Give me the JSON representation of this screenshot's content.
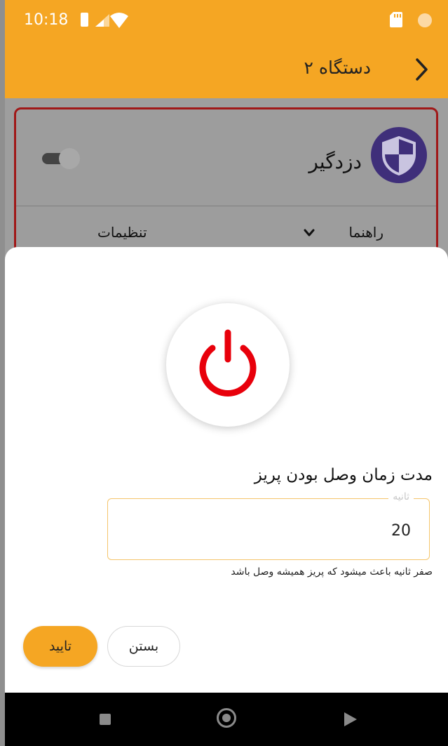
{
  "status_bar": {
    "time": "10:18",
    "icons": [
      "battery-icon",
      "signal-icon",
      "wifi-icon",
      "sd-card-icon",
      "status-dot-icon"
    ]
  },
  "app_bar": {
    "title": "دستگاه ۲",
    "back_icon": "chevron-right-icon"
  },
  "device_card": {
    "title": "دزدگیر",
    "avatar_icon": "shield-icon",
    "toggle_on": false,
    "help_label": "راهنما",
    "settings_label": "تنظیمات"
  },
  "sheet": {
    "power_icon": "power-icon",
    "duration_label": "مدت زمان وصل بودن پریز",
    "field_legend": "ثانیه",
    "field_value": "20",
    "helper": "صفر ثانیه باعث میشود که پریز همیشه وصل باشد",
    "confirm_label": "تایید",
    "close_label": "بستن"
  },
  "colors": {
    "accent": "#f5a623",
    "power_red": "#e8000b",
    "card_border": "#a01818",
    "shield_bg": "#3f2f7a"
  }
}
